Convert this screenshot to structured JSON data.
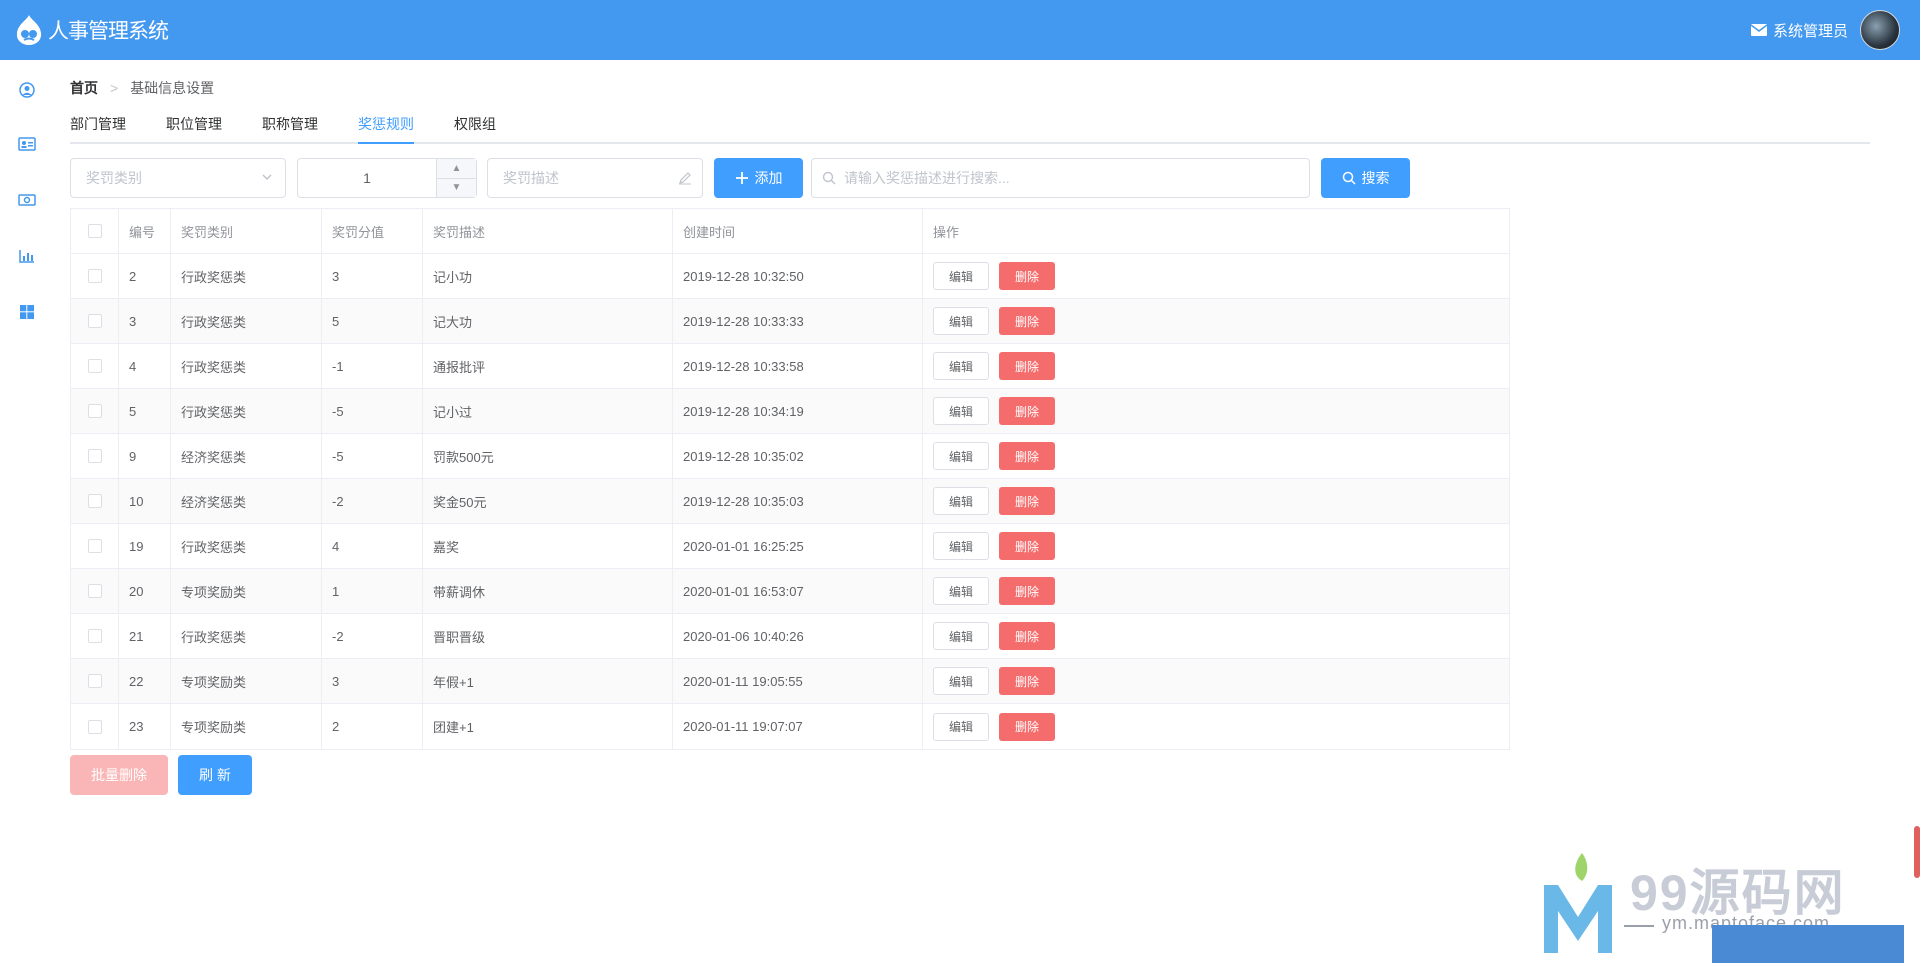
{
  "app": {
    "title": "人事管理系统",
    "user_name": "系统管理员"
  },
  "breadcrumb": {
    "home": "首页",
    "separator": ">",
    "current": "基础信息设置"
  },
  "tabs": [
    {
      "label": "部门管理",
      "active": false
    },
    {
      "label": "职位管理",
      "active": false
    },
    {
      "label": "职称管理",
      "active": false
    },
    {
      "label": "奖惩规则",
      "active": true
    },
    {
      "label": "权限组",
      "active": false
    }
  ],
  "toolbar": {
    "type_placeholder": "奖罚类别",
    "points_value": "1",
    "desc_placeholder": "奖罚描述",
    "add_label": "添加",
    "search_placeholder": "请输入奖惩描述进行搜索...",
    "search_label": "搜索"
  },
  "table": {
    "headers": {
      "id": "编号",
      "type": "奖罚类别",
      "points": "奖罚分值",
      "desc": "奖罚描述",
      "time": "创建时间",
      "ops": "操作"
    },
    "edit_label": "编辑",
    "delete_label": "删除",
    "rows": [
      {
        "id": "2",
        "type": "行政奖惩类",
        "points": "3",
        "desc": "记小功",
        "time": "2019-12-28 10:32:50"
      },
      {
        "id": "3",
        "type": "行政奖惩类",
        "points": "5",
        "desc": "记大功",
        "time": "2019-12-28 10:33:33"
      },
      {
        "id": "4",
        "type": "行政奖惩类",
        "points": "-1",
        "desc": "通报批评",
        "time": "2019-12-28 10:33:58"
      },
      {
        "id": "5",
        "type": "行政奖惩类",
        "points": "-5",
        "desc": "记小过",
        "time": "2019-12-28 10:34:19"
      },
      {
        "id": "9",
        "type": "经济奖惩类",
        "points": "-5",
        "desc": "罚款500元",
        "time": "2019-12-28 10:35:02"
      },
      {
        "id": "10",
        "type": "经济奖惩类",
        "points": "-2",
        "desc": "奖金50元",
        "time": "2019-12-28 10:35:03"
      },
      {
        "id": "19",
        "type": "行政奖惩类",
        "points": "4",
        "desc": "嘉奖",
        "time": "2020-01-01 16:25:25"
      },
      {
        "id": "20",
        "type": "专项奖励类",
        "points": "1",
        "desc": "带薪调休",
        "time": "2020-01-01 16:53:07"
      },
      {
        "id": "21",
        "type": "行政奖惩类",
        "points": "-2",
        "desc": "晋职晋级",
        "time": "2020-01-06 10:40:26"
      },
      {
        "id": "22",
        "type": "专项奖励类",
        "points": "3",
        "desc": "年假+1",
        "time": "2020-01-11 19:05:55"
      },
      {
        "id": "23",
        "type": "专项奖励类",
        "points": "2",
        "desc": "团建+1",
        "time": "2020-01-11 19:07:07"
      }
    ]
  },
  "footer": {
    "batch_delete_label": "批量删除",
    "refresh_label": "刷 新"
  },
  "watermark": {
    "brand": "99源码网",
    "url": "ym.maptoface.com"
  },
  "icons": {
    "sidebar": [
      "user-icon",
      "id-card-icon",
      "money-icon",
      "chart-icon",
      "windows-icon"
    ],
    "mail": "mail-icon",
    "search": "search-icon",
    "plus": "plus-icon"
  },
  "colors": {
    "header": "#4398ef",
    "primary": "#409eff",
    "danger": "#f56c6c",
    "danger_disabled": "#fab6b6"
  }
}
